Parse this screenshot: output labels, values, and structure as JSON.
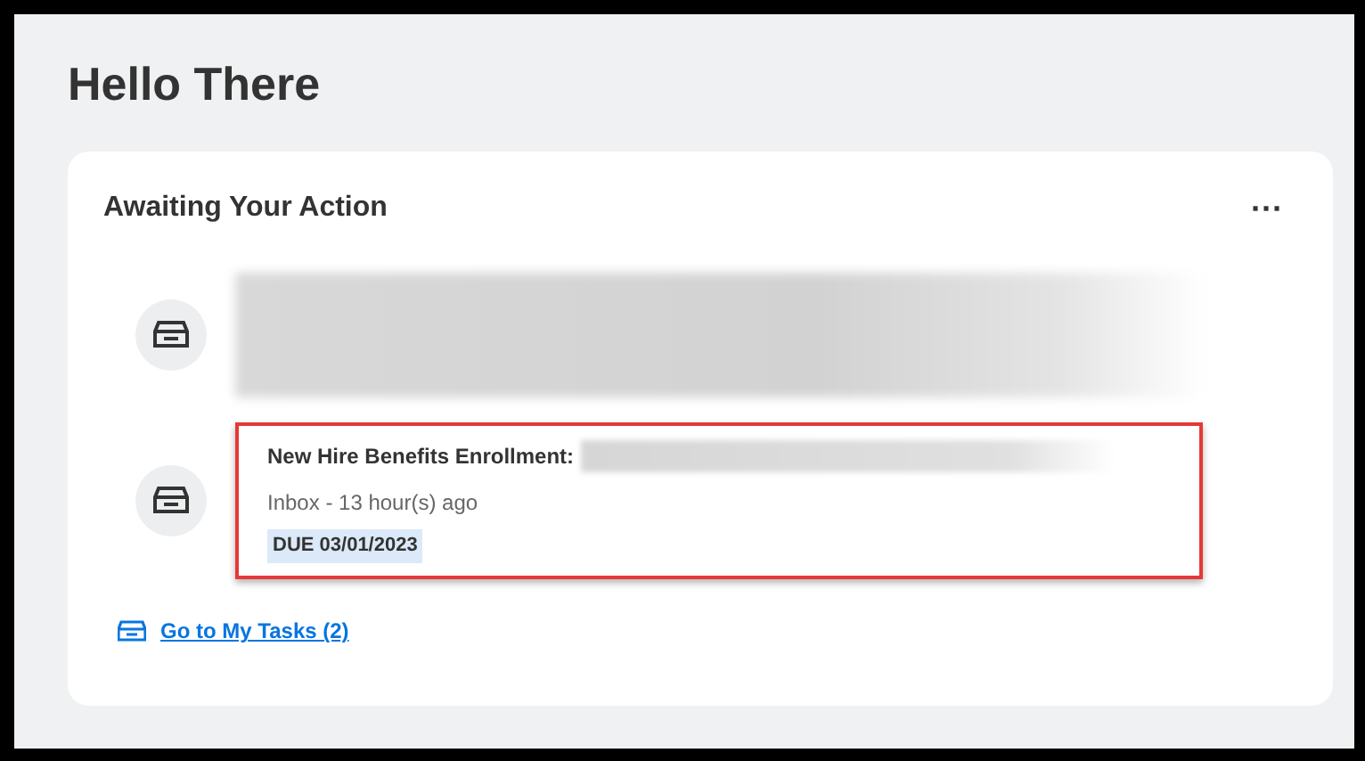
{
  "page_title": "Hello There",
  "card": {
    "title": "Awaiting Your Action",
    "menu": "···",
    "tasks": [
      {
        "kind": "redacted",
        "highlighted": false
      },
      {
        "kind": "task",
        "title": "New Hire Benefits Enrollment:",
        "meta": "Inbox - 13 hour(s) ago",
        "due": "DUE 03/01/2023",
        "highlighted": true
      }
    ],
    "link": "Go to My Tasks (2)"
  }
}
